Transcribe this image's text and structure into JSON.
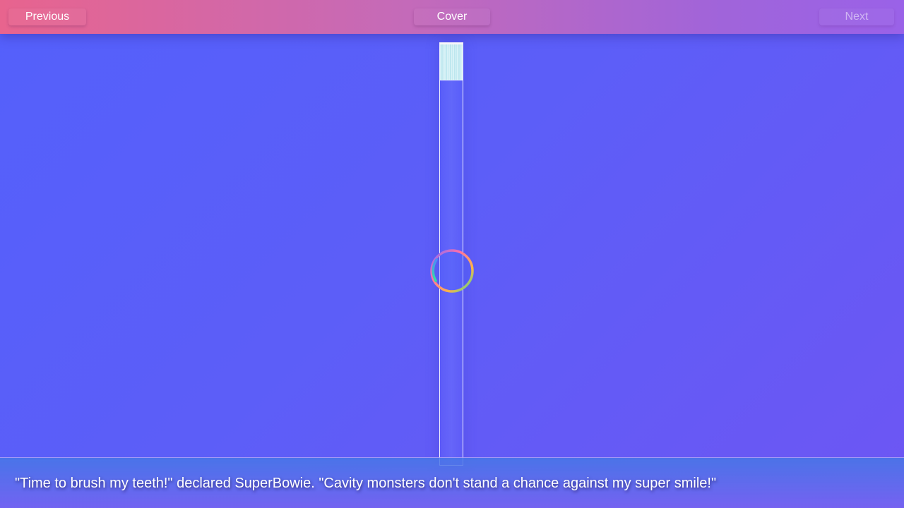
{
  "nav": {
    "previous_label": "Previous",
    "cover_label": "Cover",
    "next_label": "Next",
    "next_disabled": true
  },
  "book": {
    "caption": "\"Time to brush my teeth!\" declared SuperBowie. \"Cavity monsters don't stand a chance against my super smile!\"",
    "loading": true
  },
  "colors": {
    "topbar_start": "#e8648e",
    "topbar_end": "#9a62e8",
    "background_start": "#5460fb",
    "background_end": "#6d56f3",
    "text": "#ffffff"
  },
  "icons": {
    "loading_spinner": "loading-spinner-icon"
  }
}
